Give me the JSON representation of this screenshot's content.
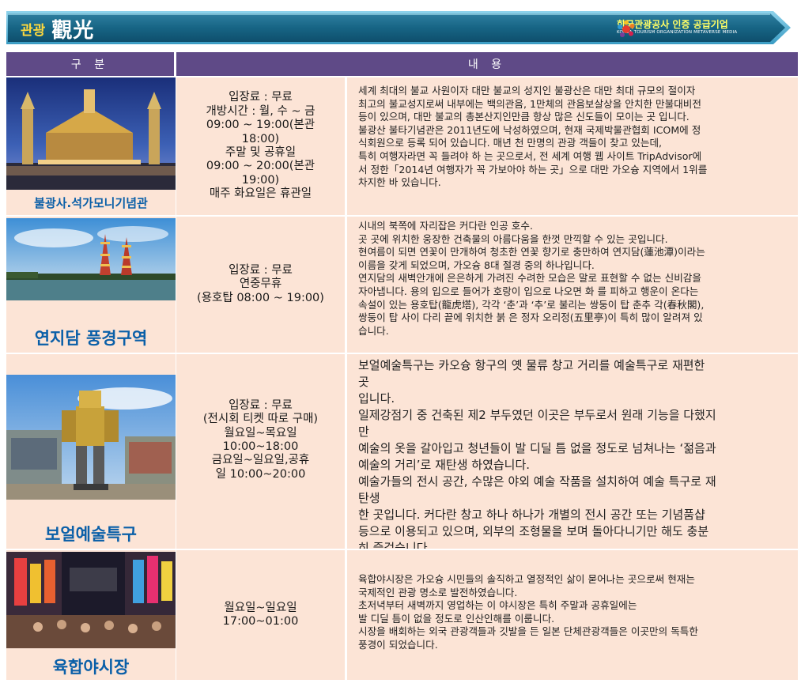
{
  "header": {
    "title_kr": "관광",
    "title_cn": "觀光",
    "logo_kr": "한국관광공사 인증 공급기업",
    "logo_en": "KOREA TOURISM ORGANIZATION METAVERSE MEDIA"
  },
  "table": {
    "col_category": "구 분",
    "col_content": "내 용"
  },
  "rows": [
    {
      "name": "불광사.석가모니기념관",
      "info": [
        "입장료 : 무료",
        "개방시간 : 월, 수 ~ 금",
        "09:00 ~ 19:00(본관",
        "18:00)",
        "주말 및 공휴일",
        "09:00 ~ 20:00(본관",
        "19:00)",
        "매주 화요일은 휴관일"
      ],
      "desc": [
        "세계 최대의 불교 사원이자 대만 불교의 성지인 불광산은 대만 최대 규모의 절이자",
        "최고의 불교성지로써 내부에는 백의관음, 1만체의 관음보살상을 안치한 만불대비전",
        "등이 있으며, 대만 불교의 총본산지인만큼 항상 많은 신도들이 모이는 곳 입니다.",
        "불광산 불타기념관은 2011년도에 낙성하였으며, 현재 국제박물관협회 ICOM에 정",
        "식회원으로 등록 되어 있습니다. 매년 천 만명의 관광 객들이 찾고 있는데,",
        "특히 여행자라면 꼭 들려야 하 는 곳으로서, 전 세계 여행 웹 사이트 TripAdvisor에",
        "서 정한「2014년 여행자가 꼭 가보아야 하는 곳」으로 대만 가오슝 지역에서 1위를",
        "차지한 바 있습니다."
      ]
    },
    {
      "name": "연지담 풍경구역",
      "info": [
        "입장료 : 무료",
        "연중무휴",
        "(용호탑 08:00 ~ 19:00)"
      ],
      "desc": [
        "시내의 북쪽에 자리잡은 커다란 인공 호수.",
        "곳 곳에 위치한 웅장한 건축물의 아름다움을 한껏 만끽할 수 있는 곳입니다.",
        "현여름이 되면 연꽃이 만개하여 청초한 연꽃 향기로 충만하여 연지담(蓮池潭)이라는",
        "이름을 갖게 되었으며, 가오슝 8대 절경 중의 하나입니다.",
        "연지담의 새벽안개에 은은하게 가려진 수려한 모습은 말로 표현할 수 없는 신비감을",
        "자아냅니다. 용의 입으로 들어가 호랑이 입으로 나오면 화 를 피하고 행운이 온다는",
        "속설이 있는 용호탑(龍虎塔), 각각 ‘춘’과 ‘추’로 불리는 쌍둥이 탑 춘추 각(春秋閣),",
        "쌍둥이 탑 사이 다리 끝에 위치한 붉 은 정자 오리정(五里亭)이 특히 많이 알려져 있",
        "습니다."
      ]
    },
    {
      "name": "보얼예술특구",
      "info": [
        "입장료 : 무료",
        "(전시회 티켓 따로 구매)",
        "월요일~목요일",
        "10:00~18:00",
        "금요일~일요일,공휴",
        "일 10:00~20:00"
      ],
      "desc": [
        "보얼예술특구는 카오슝 항구의 옛 물류 창고 거리를 예술특구로 재편한",
        "곳",
        "입니다.",
        "일제강점기 중 건축된 제2 부두였던 이곳은 부두로서 원래 기능을 다했지",
        "만",
        "예술의 옷을 갈아입고 청년들이 발 디딜 틈 없을 정도로 넘쳐나는 ‘젊음과",
        "예술의 거리’로 재탄생 하였습니다.",
        "예술가들의 전시 공간, 수많은 야외 예술 작품을 설치하여 예술 특구로 재",
        "탄생",
        "한 곳입니다. 커다란 창고 하나 하나가 개별의 전시 공간 또는 기념품샵",
        "등으로 이용되고 있으며, 외부의 조형물을 보며 돌아다니기만 해도 충분",
        "히 즐겁습니다."
      ]
    },
    {
      "name": "육합야시장",
      "info": [
        "월요일~일요일",
        "17:00~01:00"
      ],
      "desc": [
        "육합야시장은 가오슝 시민들의 솔직하고 열정적인 삶이 묻어나는 곳으로써 현재는",
        "국제적인 관광 명소로 발전하였습니다.",
        "초저녁부터 새벽까지 영업하는 이 야시장은 특히 주말과 공휴일에는",
        "발 디딜 틈이 없을 정도로 인산인해를 이룹니다.",
        "시장을 배회하는 외국 관광객들과 깃발을 든 일본 단체관광객들은 이곳만의 독특한",
        "풍경이 되었습니다."
      ]
    }
  ]
}
